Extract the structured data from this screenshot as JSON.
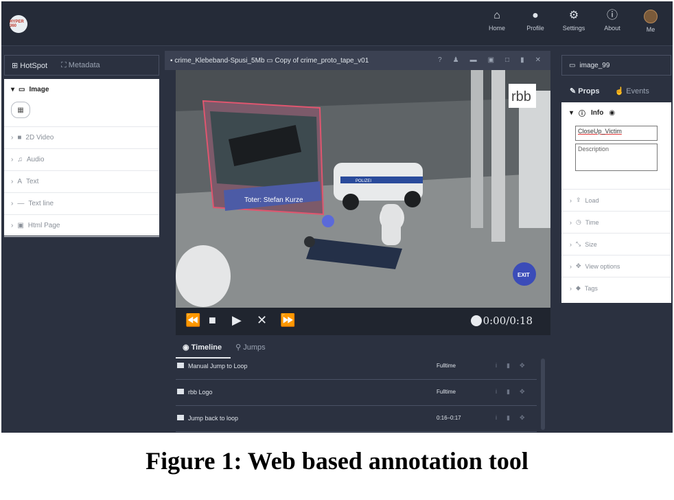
{
  "topbar": {
    "logo_text": "HYPER 360",
    "nav": [
      {
        "label": "Home",
        "icon": "home-icon"
      },
      {
        "label": "Profile",
        "icon": "user-icon"
      },
      {
        "label": "Settings",
        "icon": "settings-icon"
      },
      {
        "label": "About",
        "icon": "info-icon"
      },
      {
        "label": "Me",
        "icon": "avatar"
      }
    ]
  },
  "left": {
    "tabs": [
      "HotSpot",
      "Metadata"
    ],
    "sections": [
      "Image",
      "2D Video",
      "Audio",
      "Text",
      "Text line",
      "Html Page"
    ]
  },
  "center": {
    "title": "crime_Klebeband-Spusi_5Mb",
    "subtitle": "Copy of crime_proto_tape_v01",
    "overlay_label": "Toter: Stefan Kurze",
    "logo_text": "rbb",
    "police_text": "POLIZEI",
    "exit_label": "EXIT",
    "timecode": "0:00/0:18",
    "timeline_tabs": [
      "Timeline",
      "Jumps"
    ],
    "timeline_rows": [
      {
        "name": "Manual Jump to Loop",
        "duration": "Fulltime"
      },
      {
        "name": "rbb Logo",
        "duration": "Fulltime"
      },
      {
        "name": "Jump back to loop",
        "duration": "0:16–0:17"
      }
    ]
  },
  "right": {
    "header": "image_99",
    "tabs": [
      "Props",
      "Events"
    ],
    "info_label": "Info",
    "name_value": "CloseUp_Victim",
    "description_placeholder": "Description",
    "sections": [
      "Load",
      "Time",
      "Size",
      "View options",
      "Tags"
    ]
  },
  "caption": "Figure 1: Web based annotation tool",
  "colors": {
    "app_bg": "#2b3140",
    "panel_bg": "#ffffff",
    "accent": "#3b4cb8"
  }
}
